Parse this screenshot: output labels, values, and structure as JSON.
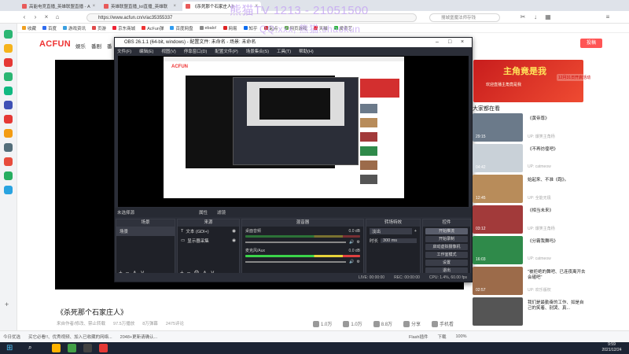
{
  "browser": {
    "tabs": [
      {
        "label": "高能电竞直播_英雄联盟直播 - A"
      },
      {
        "label": "英雄联盟直播_lol直播_英雄联"
      },
      {
        "label": "《杀死那个石家庄人》",
        "active": true
      }
    ],
    "url": "https://www.acfun.cn/v/ac35355337",
    "search_placeholder": "搜城堡魔法师存钱",
    "bookmarks": [
      {
        "label": "收藏",
        "color": "#f0a020"
      },
      {
        "label": "百度",
        "color": "#2f6cf0"
      },
      {
        "label": "游戏资讯",
        "color": "#3aa0e0"
      },
      {
        "label": "页游",
        "color": "#e04a4a"
      },
      {
        "label": "京东商城",
        "color": "#e23"
      },
      {
        "label": "AcFun弹",
        "color": "#e33"
      },
      {
        "label": "百度网盘",
        "color": "#2f9cf0"
      },
      {
        "label": "ebalo!",
        "color": "#888"
      },
      {
        "label": "网易",
        "color": "#d22"
      },
      {
        "label": "知乎",
        "color": "#0a6cf0"
      },
      {
        "label": "起点",
        "color": "#c33"
      },
      {
        "label": "网页游戏",
        "color": "#6a5"
      },
      {
        "label": "天猫",
        "color": "#e22"
      },
      {
        "label": "爱奇艺",
        "color": "#2b3"
      }
    ]
  },
  "watermark": {
    "line1": "熊猫TV 1213 - 21051500",
    "line2": "QQ:xxx, 熊猫:shaokun"
  },
  "acfun": {
    "logo": "ACFUN",
    "nav": [
      "娱乐",
      "番剧",
      "番"
    ],
    "login_label": "投稿",
    "video_title": "《杀死那个石家庄人》",
    "meta": [
      "来自作者/修改、禁止转载",
      "97.5万播放",
      "8万弹幕",
      "2475评论"
    ],
    "actions": [
      {
        "label": "1.0万",
        "icon": "thumb-up-icon"
      },
      {
        "label": "1.0万",
        "icon": "banana-icon"
      },
      {
        "label": "8.8万",
        "icon": "star-icon"
      },
      {
        "label": "分享",
        "icon": "share-icon"
      },
      {
        "label": "手机看",
        "icon": "phone-icon"
      }
    ],
    "banner": {
      "title": "主角竟是我",
      "sub": "欢迎直播主角竟是我",
      "date": "12月31日开启活动"
    },
    "related_header": "大家都在看",
    "related": [
      {
        "title": "《黄帝尊》",
        "user": "UP: 爆笑主角杨",
        "duration": "29:15",
        "color": "#6b7a8a"
      },
      {
        "title": "《不再彷徨吧》",
        "user": "UP: catmeow",
        "duration": "04:42",
        "color": "#c9d1d8"
      },
      {
        "title": "始起来、不准《跑》。",
        "user": "UP: 全能无极",
        "duration": "12:45",
        "color": "#b88c5a"
      },
      {
        "title": "《相当未来》",
        "user": "UP: 爆笑主角杨",
        "duration": "03:12",
        "color": "#a23a3a"
      },
      {
        "title": "《分霸我舞吗》",
        "user": "UP: catmeow",
        "duration": "16:03",
        "color": "#2f8a4a"
      },
      {
        "title": "\"被拒绝的舞吧、已连夜离开去会磕吧\"",
        "user": "UP: 欢乐版权",
        "duration": "02:57",
        "color": "#9c6b4a"
      },
      {
        "title": "我们是最勤奋的工作、如是自己的笑着、别哭、真...",
        "user": "",
        "duration": "",
        "color": "#555"
      }
    ]
  },
  "obs": {
    "title": "OBS 26.1.1 (64-bit, windows) - 配置文件: 未命名 - 场景: 未命名",
    "menu": [
      "文件(F)",
      "编辑(E)",
      "视图(V)",
      "停靠窗口(D)",
      "配置文件(P)",
      "场景集合(S)",
      "工具(T)",
      "帮助(H)"
    ],
    "scene_bar": [
      "未选择源",
      "属性",
      "滤镜"
    ],
    "docks": {
      "scenes": {
        "header": "场景",
        "items": [
          "场景"
        ]
      },
      "sources": {
        "header": "来源",
        "items": [
          "文本 (GDI+)",
          "显示器采集"
        ]
      },
      "mixer": {
        "header": "混音器",
        "channels": [
          {
            "name": "桌面音频",
            "db": "0.0 dB"
          },
          {
            "name": "麦克风/Aux",
            "db": "0.0 dB"
          }
        ]
      },
      "transitions": {
        "header": "转场特效",
        "type": "淡出",
        "duration_label": "时长",
        "duration": "300 ms"
      },
      "controls": {
        "header": "控件",
        "buttons": [
          "开始推流",
          "开始录制",
          "启动虚拟摄像机",
          "工作室模式",
          "设置",
          "退出"
        ]
      }
    },
    "status": [
      "LIVE: 00:00:00",
      "REC: 00:00:00",
      "CPU: 1.4%, 60.00 fps"
    ]
  },
  "statusbar": {
    "left": [
      "今日优选",
      "买它必看!!、优秀视频、加入已收藏的网络...",
      "2048+更新请确认..."
    ],
    "right": [
      "Flash插件",
      "下载",
      "100%"
    ]
  },
  "taskbar": {
    "time": "9:59",
    "date": "2021/12/24"
  }
}
